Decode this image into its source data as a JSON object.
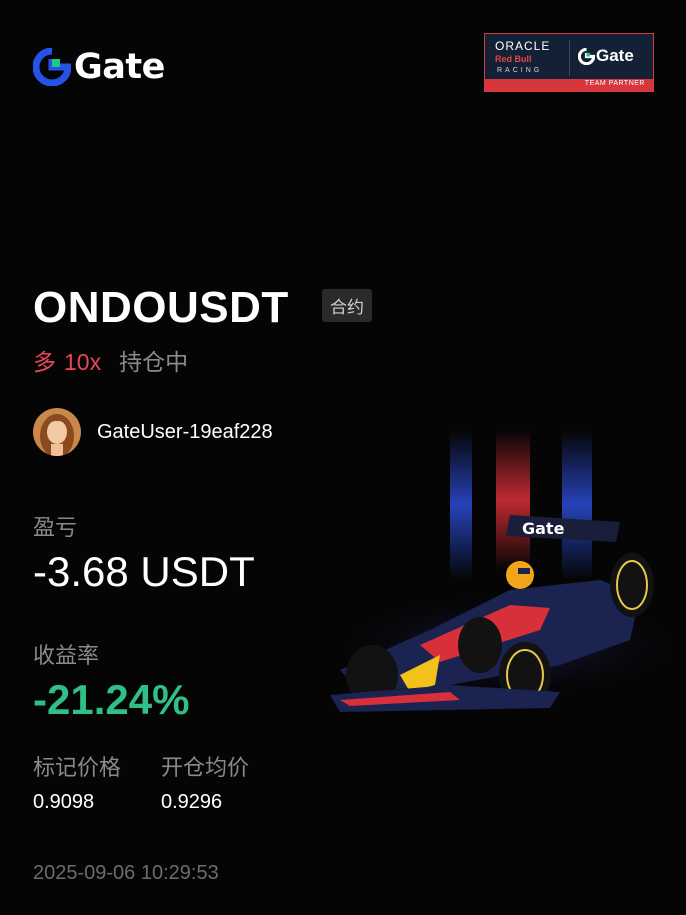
{
  "brand": {
    "name": "Gate",
    "accent": "#2354e6",
    "accent_green": "#1fc888"
  },
  "partner_badge": {
    "oracle": "ORACLE",
    "red_bull": "Red Bull",
    "racing": "RACING",
    "gate": "Gate",
    "team_partner": "TEAM PARTNER"
  },
  "position": {
    "symbol": "ONDOUSDT",
    "type_tag": "合约",
    "direction": "多",
    "leverage": "10x",
    "status": "持仓中"
  },
  "user": {
    "name": "GateUser-19eaf228"
  },
  "pnl": {
    "label": "盈亏",
    "value": "-3.68 USDT"
  },
  "roi": {
    "label": "收益率",
    "value": "-21.24%",
    "color": "#2fbf87"
  },
  "prices": {
    "mark_label": "标记价格",
    "mark_value": "0.9098",
    "entry_label": "开仓均价",
    "entry_value": "0.9296"
  },
  "timestamp": "2025-09-06 10:29:53",
  "colors": {
    "long": "#e8475a",
    "muted": "#8a8a8a",
    "background": "#050505"
  }
}
